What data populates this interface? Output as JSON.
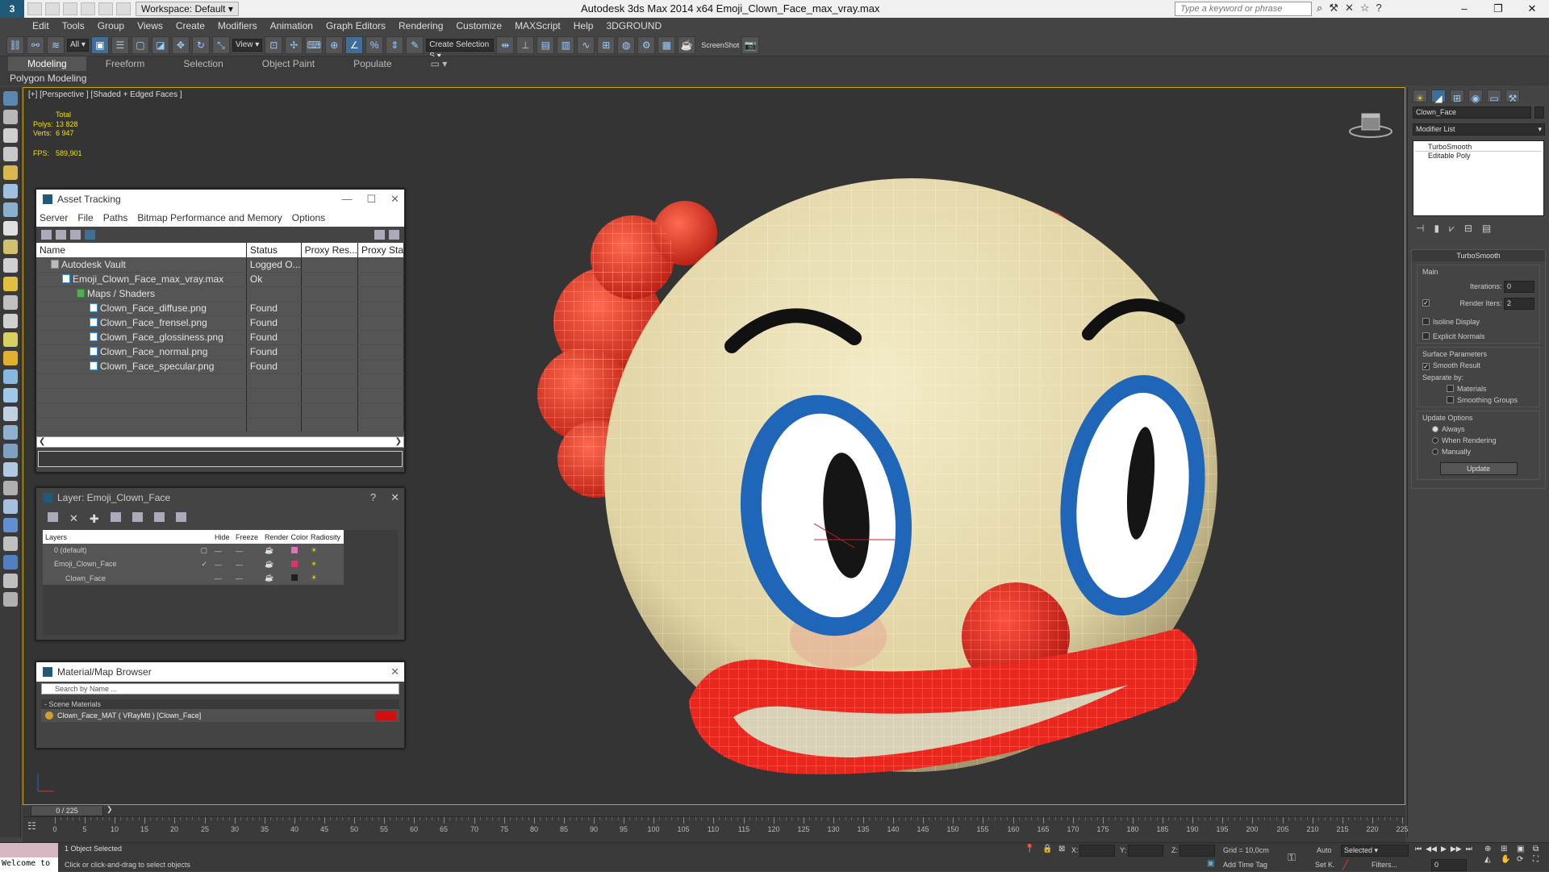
{
  "window": {
    "title": "Autodesk 3ds Max  2014 x64     Emoji_Clown_Face_max_vray.max",
    "workspace": "Workspace: Default",
    "search_placeholder": "Type a keyword or phrase"
  },
  "menu": [
    "Edit",
    "Tools",
    "Group",
    "Views",
    "Create",
    "Modifiers",
    "Animation",
    "Graph Editors",
    "Rendering",
    "Customize",
    "MAXScript",
    "Help",
    "3DGROUND"
  ],
  "toolbar": {
    "filter": "All",
    "refcoord": "View",
    "selection_set": "Create Selection S",
    "screenshot_label": "ScreenShot"
  },
  "ribbon": {
    "tabs": [
      "Modeling",
      "Freeform",
      "Selection",
      "Object Paint",
      "Populate"
    ],
    "active_tab": "Modeling",
    "sub_label": "Polygon Modeling"
  },
  "viewport": {
    "label": "[+] [Perspective ] [Shaded + Edged Faces ]",
    "stats": {
      "total_label": "Total",
      "polys_label": "Polys:",
      "polys_value": "13 828",
      "verts_label": "Verts:",
      "verts_value": "6 947",
      "fps_label": "FPS:",
      "fps_value": "589,901"
    }
  },
  "asset_tracking": {
    "title": "Asset Tracking",
    "menu": [
      "Server",
      "File",
      "Paths",
      "Bitmap Performance and Memory",
      "Options"
    ],
    "columns": [
      "Name",
      "Status",
      "Proxy Res...",
      "Proxy Sta"
    ],
    "rows": [
      {
        "name": "Autodesk Vault",
        "status": "Logged O...",
        "indent": 1
      },
      {
        "name": "Emoji_Clown_Face_max_vray.max",
        "status": "Ok",
        "indent": 2
      },
      {
        "name": "Maps / Shaders",
        "status": "",
        "indent": 3
      },
      {
        "name": "Clown_Face_diffuse.png",
        "status": "Found",
        "indent": 4
      },
      {
        "name": "Clown_Face_frensel.png",
        "status": "Found",
        "indent": 4
      },
      {
        "name": "Clown_Face_glossiness.png",
        "status": "Found",
        "indent": 4
      },
      {
        "name": "Clown_Face_normal.png",
        "status": "Found",
        "indent": 4
      },
      {
        "name": "Clown_Face_specular.png",
        "status": "Found",
        "indent": 4
      }
    ]
  },
  "layer_dialog": {
    "title": "Layer: Emoji_Clown_Face",
    "help": "?",
    "columns": [
      "Layers",
      "Hide",
      "Freeze",
      "Render",
      "Color",
      "Radiosity"
    ],
    "rows": [
      {
        "name": "0 (default)",
        "color": "#e070c0"
      },
      {
        "name": "Emoji_Clown_Face",
        "color": "#e03070"
      },
      {
        "name": "Clown_Face",
        "color": "#202020"
      }
    ]
  },
  "material_browser": {
    "title": "Material/Map Browser",
    "search_placeholder": "Search by Name ...",
    "group": "- Scene Materials",
    "item": "Clown_Face_MAT  ( VRayMtl )  [Clown_Face]"
  },
  "command_panel": {
    "object_name": "Clown_Face",
    "modifier_list": "Modifier List",
    "stack": [
      "TurboSmooth",
      "Editable Poly"
    ],
    "rollout_title": "TurboSmooth",
    "main_label": "Main",
    "iterations_label": "Iterations:",
    "iterations_value": "0",
    "render_iters_label": "Render Iters:",
    "render_iters_value": "2",
    "isoline": "Isoline Display",
    "explicit": "Explicit Normals",
    "surface_label": "Surface Parameters",
    "smooth_result": "Smooth Result",
    "separate_by": "Separate by:",
    "materials": "Materials",
    "smoothing_groups": "Smoothing Groups",
    "update_options": "Update Options",
    "always": "Always",
    "when_rendering": "When Rendering",
    "manually": "Manually",
    "update_button": "Update"
  },
  "timeline": {
    "frame_display": "0 / 225",
    "ticks": [
      "0",
      "5",
      "10",
      "15",
      "20",
      "25",
      "30",
      "35",
      "40",
      "45",
      "50",
      "55",
      "60",
      "65",
      "70",
      "75",
      "80",
      "85",
      "90",
      "95",
      "100",
      "105",
      "110",
      "115",
      "120",
      "125",
      "130",
      "135",
      "140",
      "145",
      "150",
      "155",
      "160",
      "165",
      "170",
      "175",
      "180",
      "185",
      "190",
      "195",
      "200",
      "205",
      "210",
      "215",
      "220",
      "225"
    ]
  },
  "status": {
    "welcome": "Welcome to",
    "selected": "1 Object Selected",
    "prompt": "Click or click-and-drag to select objects",
    "x_label": "X:",
    "y_label": "Y:",
    "z_label": "Z:",
    "grid": "Grid = 10,0cm",
    "add_time_tag": "Add Time Tag",
    "auto": "Auto",
    "set_k": "Set K.",
    "selected_dropdown": "Selected",
    "filters": "Filters...",
    "frame": "0"
  },
  "colors": {
    "accent": "#3d6f9a",
    "viewport_border": "#c8a000",
    "face": "#e8dcae",
    "clown_red": "#e8271f",
    "eye_blue": "#1f66b8"
  }
}
